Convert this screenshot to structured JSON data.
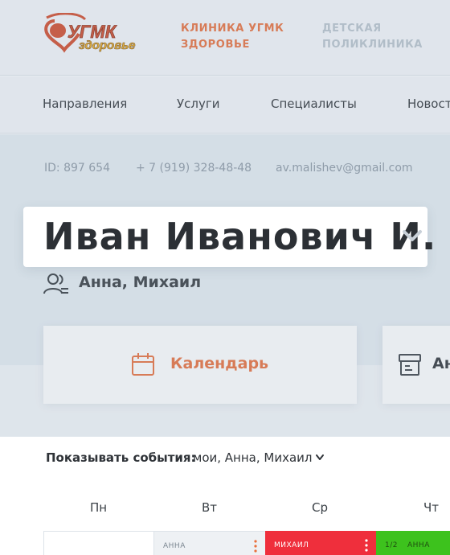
{
  "header": {
    "logo_text": "УГМК здоровье",
    "clinic_active": "КЛИНИКА УГМК ЗДОРОВЬЕ",
    "clinic_active_line1": "КЛИНИКА УГМК",
    "clinic_active_line2": "ЗДОРОВЬЕ",
    "clinic_muted_line1": "ДЕТСКАЯ",
    "clinic_muted_line2": "ПОЛИКЛИНИКА"
  },
  "nav": {
    "items": [
      "Направления",
      "Услуги",
      "Специалисты",
      "Новости"
    ]
  },
  "profile": {
    "id": "ID: 897 654",
    "phone": "+ 7 (919) 328-48-48",
    "email": "av.malishev@gmail.com",
    "name": "Иван Иванович И.",
    "family": "Анна, Михаил"
  },
  "tabs": {
    "calendar": "Календарь",
    "other": "Ан"
  },
  "calendar": {
    "filter_label": "Показывать события:",
    "filter_value": "мои, Анна, Михаил",
    "days": [
      "Пн",
      "Вт",
      "Ср",
      "Чт"
    ],
    "tue_event": "АННА",
    "wed_event": "МИХАИЛ",
    "thu_count": "1/2",
    "thu_event": "АННА"
  },
  "colors": {
    "accent_orange": "#ea6f3b",
    "event_red": "#ef2f3c",
    "event_green": "#3dc21d",
    "event_gray": "#eef1f4"
  }
}
